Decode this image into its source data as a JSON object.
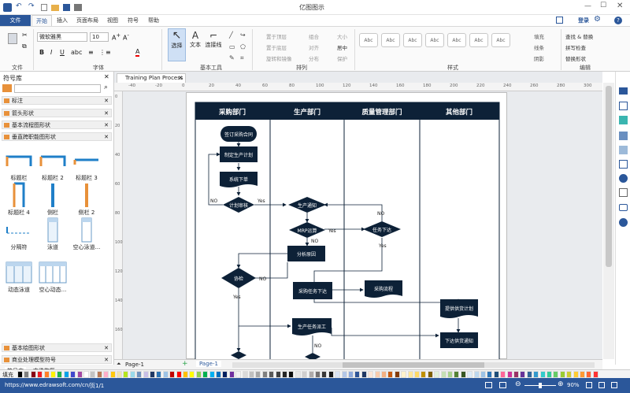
{
  "app": {
    "title": "亿图图示",
    "login": "登录"
  },
  "menu": {
    "tabs": [
      "文件",
      "开始",
      "插入",
      "页面布局",
      "视图",
      "符号",
      "帮助"
    ]
  },
  "ribbon": {
    "groups": {
      "file": "文件",
      "font": "字体",
      "basic_tools": "基本工具",
      "arrange": "排列",
      "style": "样式",
      "edit": "编辑"
    },
    "font_name": "微软雅黑",
    "font_size": "10",
    "tools": {
      "select": "选择",
      "text": "文本",
      "connector": "连接线"
    },
    "arrange_items": [
      "置于顶层",
      "组合",
      "大小",
      "置于底层",
      "对齐",
      "居中",
      "旋转和镜像",
      "分布",
      "保护"
    ],
    "style_box_label": "Abc",
    "style_side": [
      "填充",
      "线条",
      "阴影"
    ],
    "edit_items": [
      "查找 & 替换",
      "拼写检查",
      "替换形状"
    ]
  },
  "left_panel": {
    "title": "符号库",
    "libraries": [
      "标注",
      "箭头形状",
      "基本流程图形状",
      "垂直跨职能图形状"
    ],
    "shapes": [
      "标题栏",
      "标题栏 2",
      "标题栏 3",
      "标题栏 4",
      "侧栏",
      "侧栏 2",
      "分隔符",
      "泳道",
      "空心泳道...",
      "动态泳道",
      "空心动态..."
    ],
    "bottom_libraries": [
      "基本绘图形状",
      "商业处理模型符号"
    ],
    "bottom_tabs": [
      "符号库",
      "文件恢复"
    ]
  },
  "document": {
    "tab": "Training Plan Process"
  },
  "ruler": {
    "h": [
      "-40",
      "-20",
      "0",
      "20",
      "40",
      "60",
      "80",
      "100",
      "120",
      "140",
      "160",
      "180",
      "200",
      "220",
      "240",
      "260",
      "280",
      "300"
    ],
    "v": [
      "0",
      "20",
      "40",
      "60",
      "80",
      "100",
      "120",
      "140",
      "160"
    ]
  },
  "diagram": {
    "lanes": [
      "采购部门",
      "生产部门",
      "质量管理部门",
      "其他部门"
    ],
    "nodes": {
      "n1": "签订采购合同",
      "n2": "制定生产计划",
      "n3": "系统下单",
      "n4": "计划审核",
      "n5": "生产通知",
      "n6": "MRP运算",
      "n7": "任务下达",
      "n8": "分析原因",
      "n9": "协检",
      "n10": "采购任务下达",
      "n11": "采购流程",
      "n12": "提供供货计划",
      "n13": "生产任务派工",
      "n14": "下达供货通知"
    },
    "labels": {
      "no": "NO",
      "yes": "Yes"
    }
  },
  "pagebar": {
    "page_a": "Page-1",
    "page_b": "Page-1"
  },
  "palette": {
    "label": "填充",
    "colors": [
      "#000000",
      "#7f7f7f",
      "#880015",
      "#ed1c24",
      "#ff7f27",
      "#fff200",
      "#22b14c",
      "#00a2e8",
      "#3f48cc",
      "#a349a4",
      "#ffffff",
      "#c3c3c3",
      "#b97a57",
      "#ffaec9",
      "#ffc90e",
      "#efe4b0",
      "#b5e61d",
      "#99d9ea",
      "#7092be",
      "#c8bfe7",
      "#1f3864",
      "#2e75b6",
      "#9dc3e6",
      "#c00000",
      "#ff0000",
      "#ffc000",
      "#ffff00",
      "#92d050",
      "#00b050",
      "#00b0f0",
      "#0070c0",
      "#002060",
      "#7030a0",
      "#f2f2f2",
      "#d9d9d9",
      "#bfbfbf",
      "#a6a6a6",
      "#808080",
      "#595959",
      "#404040",
      "#262626",
      "#0d0d0d",
      "#e7e6e6",
      "#d0cece",
      "#aeaaaa",
      "#757171",
      "#3a3838",
      "#171616",
      "#dae3f3",
      "#b4c7e7",
      "#8faadc",
      "#2f5597",
      "#203864",
      "#fbe5d6",
      "#f8cbad",
      "#f4b183",
      "#c55a11",
      "#843c0c",
      "#fff2cc",
      "#ffe699",
      "#ffd966",
      "#bf9000",
      "#7f6000",
      "#e2f0d9",
      "#c5e0b4",
      "#a9d18e",
      "#548235",
      "#385723",
      "#deebf7",
      "#bdd7ee",
      "#9dc3e6",
      "#2e75b6",
      "#1f4e79",
      "#ff6699",
      "#cc3399",
      "#993366",
      "#663399",
      "#336699",
      "#3399cc",
      "#33cccc",
      "#33cc99",
      "#66cc66",
      "#99cc33",
      "#cccc33",
      "#ffcc33",
      "#ff9933",
      "#ff6633",
      "#ff3333"
    ]
  },
  "status": {
    "url": "https://www.edrawsoft.com/cn/",
    "page": "页1/1",
    "zoom": "90%"
  }
}
